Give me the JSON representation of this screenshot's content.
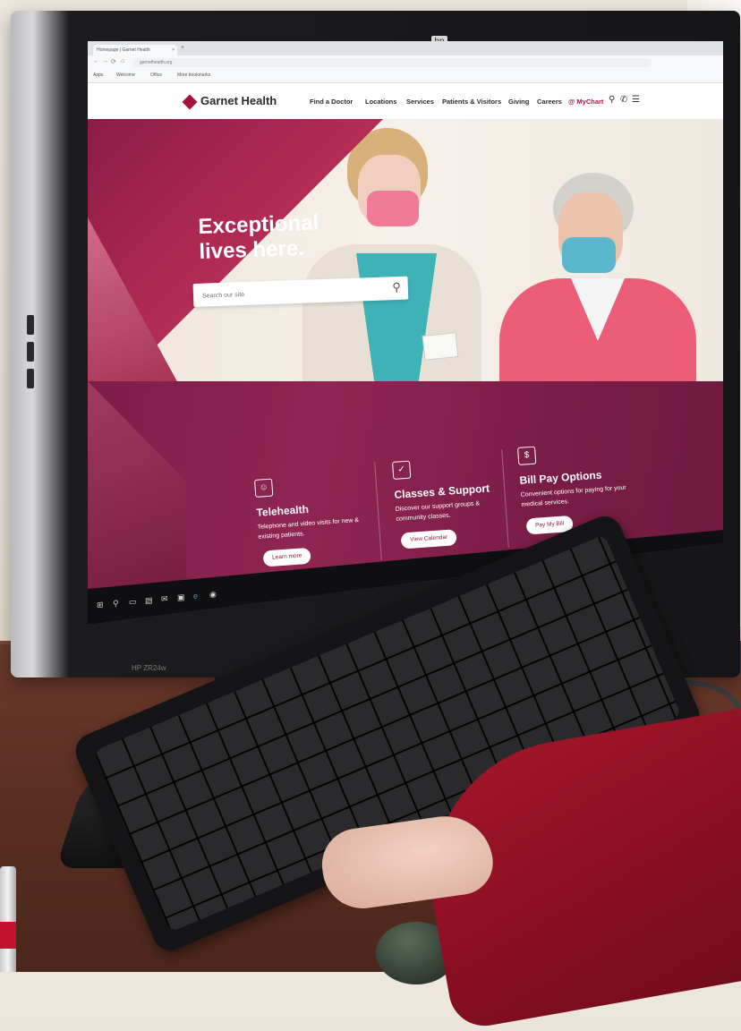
{
  "browser": {
    "tab_title": "Homepage | Garnet Health",
    "tab_close": "×",
    "new_tab": "+",
    "url": "garnethealth.org",
    "nav": {
      "back": "←",
      "forward": "→",
      "reload": "⟳",
      "home": "⌂"
    },
    "bookmarks": [
      "Apps",
      "Welcome",
      "Office",
      "More bookmarks"
    ]
  },
  "site": {
    "brand": "Garnet Health",
    "nav": [
      "Find a Doctor",
      "Locations",
      "Services",
      "Patients & Visitors",
      "Giving",
      "Careers"
    ],
    "mychart": "@ MyChart",
    "icons": {
      "search": "⚲",
      "phone": "✆",
      "menu": "☰"
    }
  },
  "hero": {
    "title_line1": "Exceptional",
    "title_line2": "lives here.",
    "search_placeholder": "Search our site",
    "search_icon": "⚲"
  },
  "cards": [
    {
      "icon": "☺",
      "title": "Telehealth",
      "desc": "Telephone and video visits for new & existing patients.",
      "button": "Learn more"
    },
    {
      "icon": "✓",
      "title": "Classes & Support",
      "desc": "Discover our support groups & community classes.",
      "button": "View Calendar"
    },
    {
      "icon": "$",
      "title": "Bill Pay Options",
      "desc": "Convenient options for paying for your medical services.",
      "button": "Pay My Bill"
    }
  ],
  "monitor": {
    "model": "HP ZR24w",
    "logo": "hp"
  },
  "colors": {
    "brand": "#a3123a",
    "card_bg": "#7d1d48",
    "button_text": "#8a1f4d"
  },
  "taskbar_icons": [
    "windows-start",
    "search",
    "task-view",
    "explorer",
    "mail",
    "store",
    "edge",
    "chrome"
  ]
}
